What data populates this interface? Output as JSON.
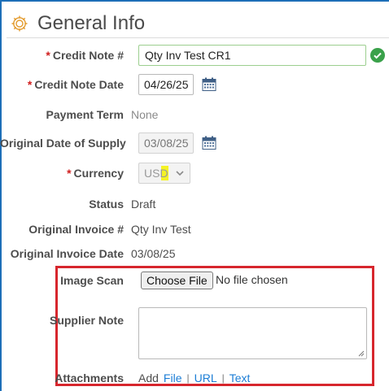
{
  "header": {
    "title": "General Info"
  },
  "fields": {
    "credit_note_no": {
      "label": "Credit Note #",
      "value": "Qty Inv Test CR1",
      "required": "*"
    },
    "credit_note_date": {
      "label": "Credit Note Date",
      "value": "04/26/25",
      "required": "*"
    },
    "payment_term": {
      "label": "Payment Term",
      "value": "None"
    },
    "original_date_supply": {
      "label": "Original Date of Supply",
      "value": "03/08/25"
    },
    "currency": {
      "label": "Currency",
      "value": "USD",
      "required": "*"
    },
    "status": {
      "label": "Status",
      "value": "Draft"
    },
    "original_invoice": {
      "label": "Original Invoice #",
      "value": "Qty Inv Test"
    },
    "original_invoice_date": {
      "label": "Original Invoice Date",
      "value": "03/08/25"
    },
    "image_scan": {
      "label": "Image Scan",
      "button": "Choose File",
      "status": "No file chosen"
    },
    "supplier_note": {
      "label": "Supplier Note",
      "value": ""
    },
    "attachments": {
      "label": "Attachments",
      "prefix": "Add",
      "file": "File",
      "url": "URL",
      "text": "Text",
      "separator": "|"
    }
  },
  "colors": {
    "accent": "#1d6fb8",
    "required": "#d01d1d",
    "valid": "#3aa14a",
    "highlight_box": "#d7262d",
    "link": "#1d7ed6"
  },
  "icons": {
    "header": "gear-icon",
    "valid": "checkmark-icon",
    "date": "calendar-icon",
    "select": "chevron-down-icon"
  }
}
